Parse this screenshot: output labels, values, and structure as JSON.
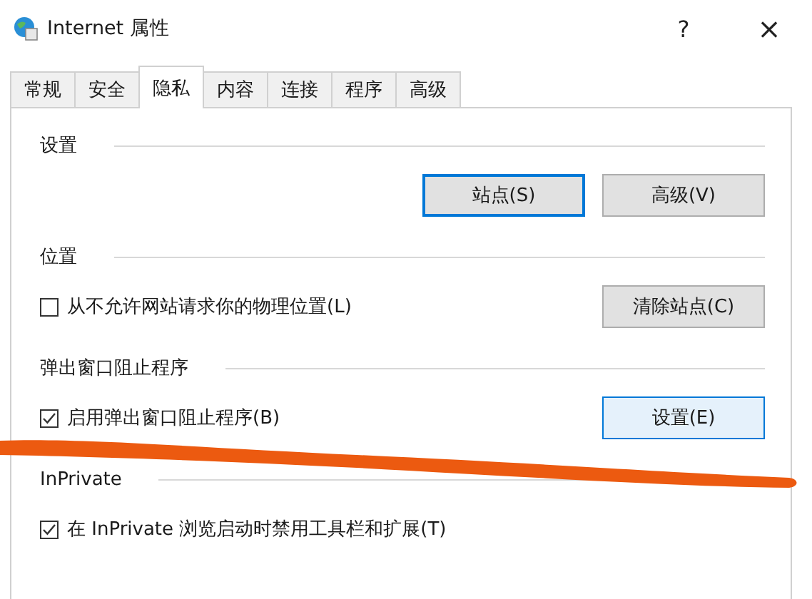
{
  "window": {
    "title": "Internet 属性",
    "help": "?",
    "close": "×"
  },
  "tabs": [
    {
      "label": "常规",
      "selected": false
    },
    {
      "label": "安全",
      "selected": false
    },
    {
      "label": "隐私",
      "selected": true
    },
    {
      "label": "内容",
      "selected": false
    },
    {
      "label": "连接",
      "selected": false
    },
    {
      "label": "程序",
      "selected": false
    },
    {
      "label": "高级",
      "selected": false
    }
  ],
  "sections": [
    {
      "title": "设置",
      "buttons": [
        {
          "label": "站点(S)",
          "focused": true,
          "hot": false
        },
        {
          "label": "高级(V)",
          "focused": false,
          "hot": false
        }
      ]
    },
    {
      "title": "位置",
      "checkbox": {
        "label": "从不允许网站请求你的物理位置(L)",
        "checked": false
      },
      "buttons": [
        {
          "label": "清除站点(C)",
          "focused": false,
          "hot": false
        }
      ]
    },
    {
      "title": "弹出窗口阻止程序",
      "checkbox": {
        "label": "启用弹出窗口阻止程序(B)",
        "checked": true
      },
      "buttons": [
        {
          "label": "设置(E)",
          "focused": false,
          "hot": true
        }
      ]
    },
    {
      "title": "InPrivate",
      "checkbox": {
        "label": "在 InPrivate 浏览启动时禁用工具栏和扩展(T)",
        "checked": true
      }
    }
  ],
  "annotation": {
    "kind": "stroke"
  }
}
